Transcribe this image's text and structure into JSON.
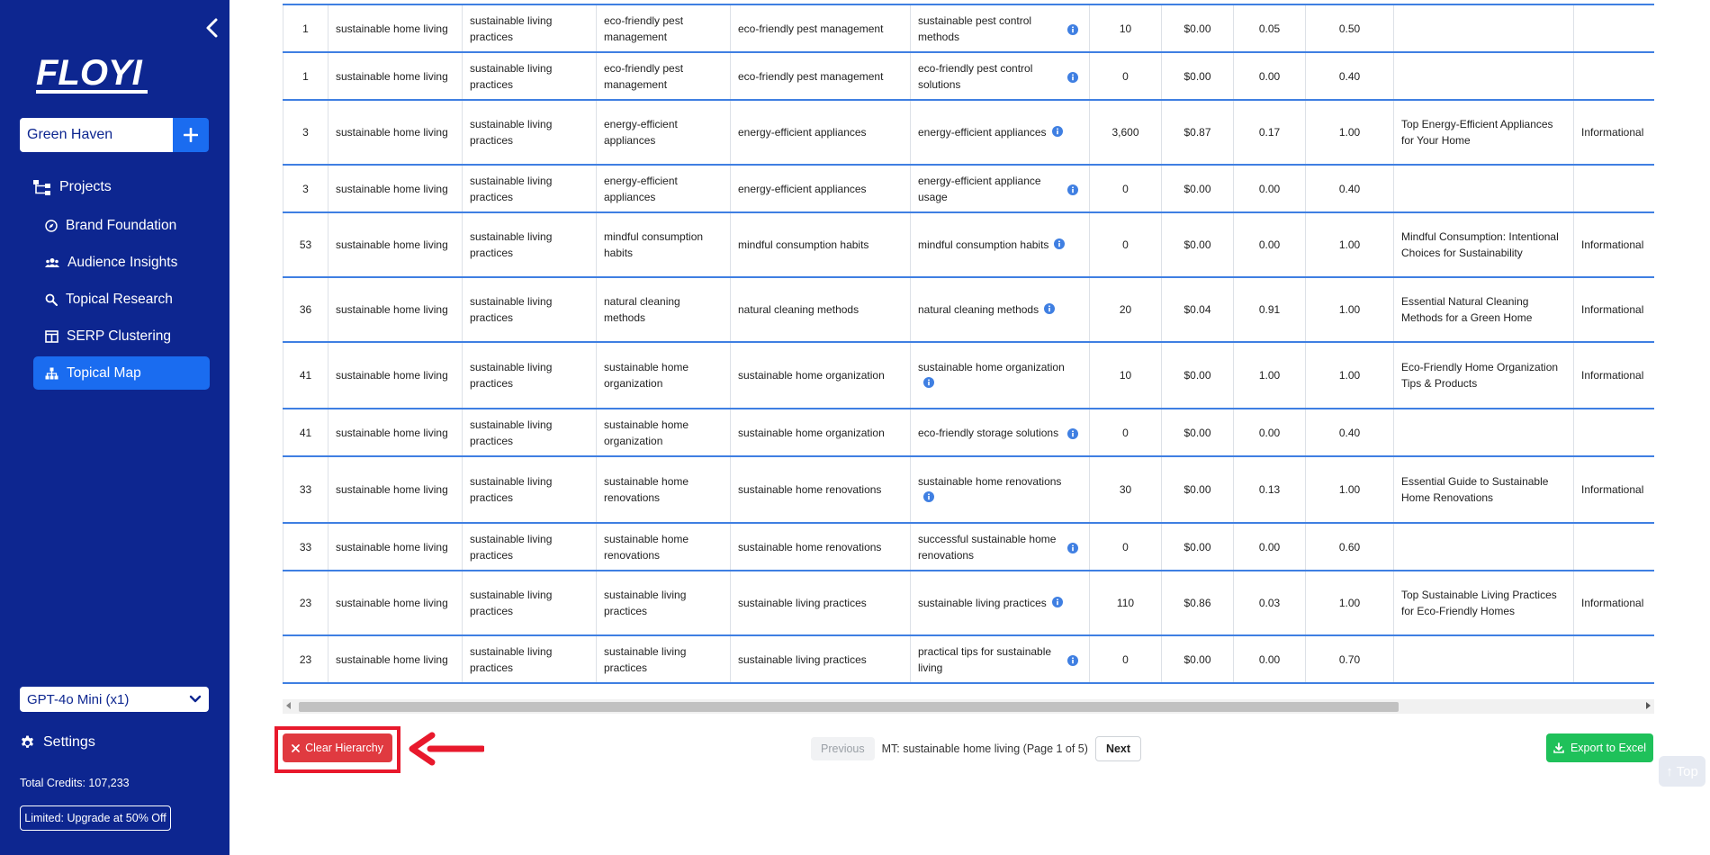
{
  "sidebar": {
    "logo_text": "FLOYI",
    "project_name": "Green Haven",
    "projects_label": "Projects",
    "nav": [
      {
        "label": "Brand Foundation",
        "icon": "compass-icon"
      },
      {
        "label": "Audience Insights",
        "icon": "users-icon"
      },
      {
        "label": "Topical Research",
        "icon": "search-icon"
      },
      {
        "label": "SERP Clustering",
        "icon": "columns-icon"
      },
      {
        "label": "Topical Map",
        "icon": "sitemap-icon",
        "active": true
      }
    ],
    "model": "GPT-4o Mini (x1)",
    "settings_label": "Settings",
    "credits": "Total Credits: 107,233",
    "upgrade": "Limited: Upgrade at 50% Off"
  },
  "table": {
    "rows": [
      {
        "id": "1",
        "mt": "sustainable home living",
        "pillar": "sustainable living practices",
        "cluster": "eco-friendly pest management",
        "topic": "eco-friendly pest management",
        "keyword": "sustainable pest control methods",
        "volume": "10",
        "cpc": "$0.00",
        "comp": "0.05",
        "score": "0.50",
        "title": "",
        "intent": ""
      },
      {
        "id": "1",
        "mt": "sustainable home living",
        "pillar": "sustainable living practices",
        "cluster": "eco-friendly pest management",
        "topic": "eco-friendly pest management",
        "keyword": "eco-friendly pest control solutions",
        "volume": "0",
        "cpc": "$0.00",
        "comp": "0.00",
        "score": "0.40",
        "title": "",
        "intent": ""
      },
      {
        "id": "3",
        "mt": "sustainable home living",
        "pillar": "sustainable living practices",
        "cluster": "energy-efficient appliances",
        "topic": "energy-efficient appliances",
        "keyword": "energy-efficient appliances",
        "volume": "3,600",
        "cpc": "$0.87",
        "comp": "0.17",
        "score": "1.00",
        "title": "Top Energy-Efficient Appliances for Your Home",
        "intent": "Informational"
      },
      {
        "id": "3",
        "mt": "sustainable home living",
        "pillar": "sustainable living practices",
        "cluster": "energy-efficient appliances",
        "topic": "energy-efficient appliances",
        "keyword": "energy-efficient appliance usage",
        "volume": "0",
        "cpc": "$0.00",
        "comp": "0.00",
        "score": "0.40",
        "title": "",
        "intent": ""
      },
      {
        "id": "53",
        "mt": "sustainable home living",
        "pillar": "sustainable living practices",
        "cluster": "mindful consumption habits",
        "topic": "mindful consumption habits",
        "keyword": "mindful consumption habits",
        "volume": "0",
        "cpc": "$0.00",
        "comp": "0.00",
        "score": "1.00",
        "title": "Mindful Consumption: Intentional Choices for Sustainability",
        "intent": "Informational"
      },
      {
        "id": "36",
        "mt": "sustainable home living",
        "pillar": "sustainable living practices",
        "cluster": "natural cleaning methods",
        "topic": "natural cleaning methods",
        "keyword": "natural cleaning methods",
        "volume": "20",
        "cpc": "$0.04",
        "comp": "0.91",
        "score": "1.00",
        "title": "Essential Natural Cleaning Methods for a Green Home",
        "intent": "Informational"
      },
      {
        "id": "41",
        "mt": "sustainable home living",
        "pillar": "sustainable living practices",
        "cluster": "sustainable home organization",
        "topic": "sustainable home organization",
        "keyword": "sustainable home organization",
        "volume": "10",
        "cpc": "$0.00",
        "comp": "1.00",
        "score": "1.00",
        "title": "Eco-Friendly Home Organization Tips & Products",
        "intent": "Informational"
      },
      {
        "id": "41",
        "mt": "sustainable home living",
        "pillar": "sustainable living practices",
        "cluster": "sustainable home organization",
        "topic": "sustainable home organization",
        "keyword": "eco-friendly storage solutions",
        "volume": "0",
        "cpc": "$0.00",
        "comp": "0.00",
        "score": "0.40",
        "title": "",
        "intent": ""
      },
      {
        "id": "33",
        "mt": "sustainable home living",
        "pillar": "sustainable living practices",
        "cluster": "sustainable home renovations",
        "topic": "sustainable home renovations",
        "keyword": "sustainable home renovations",
        "volume": "30",
        "cpc": "$0.00",
        "comp": "0.13",
        "score": "1.00",
        "title": "Essential Guide to Sustainable Home Renovations",
        "intent": "Informational"
      },
      {
        "id": "33",
        "mt": "sustainable home living",
        "pillar": "sustainable living practices",
        "cluster": "sustainable home renovations",
        "topic": "sustainable home renovations",
        "keyword": "successful sustainable home renovations",
        "volume": "0",
        "cpc": "$0.00",
        "comp": "0.00",
        "score": "0.60",
        "title": "",
        "intent": ""
      },
      {
        "id": "23",
        "mt": "sustainable home living",
        "pillar": "sustainable living practices",
        "cluster": "sustainable living practices",
        "topic": "sustainable living practices",
        "keyword": "sustainable living practices",
        "volume": "110",
        "cpc": "$0.86",
        "comp": "0.03",
        "score": "1.00",
        "title": "Top Sustainable Living Practices for Eco-Friendly Homes",
        "intent": "Informational"
      },
      {
        "id": "23",
        "mt": "sustainable home living",
        "pillar": "sustainable living practices",
        "cluster": "sustainable living practices",
        "topic": "sustainable living practices",
        "keyword": "practical tips for sustainable living",
        "volume": "0",
        "cpc": "$0.00",
        "comp": "0.00",
        "score": "0.70",
        "title": "",
        "intent": ""
      }
    ]
  },
  "footer": {
    "clear_label": "Clear Hierarchy",
    "prev_label": "Previous",
    "page_info": "MT: sustainable home living (Page 1 of 5)",
    "next_label": "Next",
    "export_label": "Export to Excel",
    "top_label": "↑ Top"
  },
  "colors": {
    "sidebar": "#0d2690",
    "accent": "#1a6cf0",
    "danger": "#e03a40",
    "success": "#1fc15a",
    "annotation": "#e8192c"
  }
}
